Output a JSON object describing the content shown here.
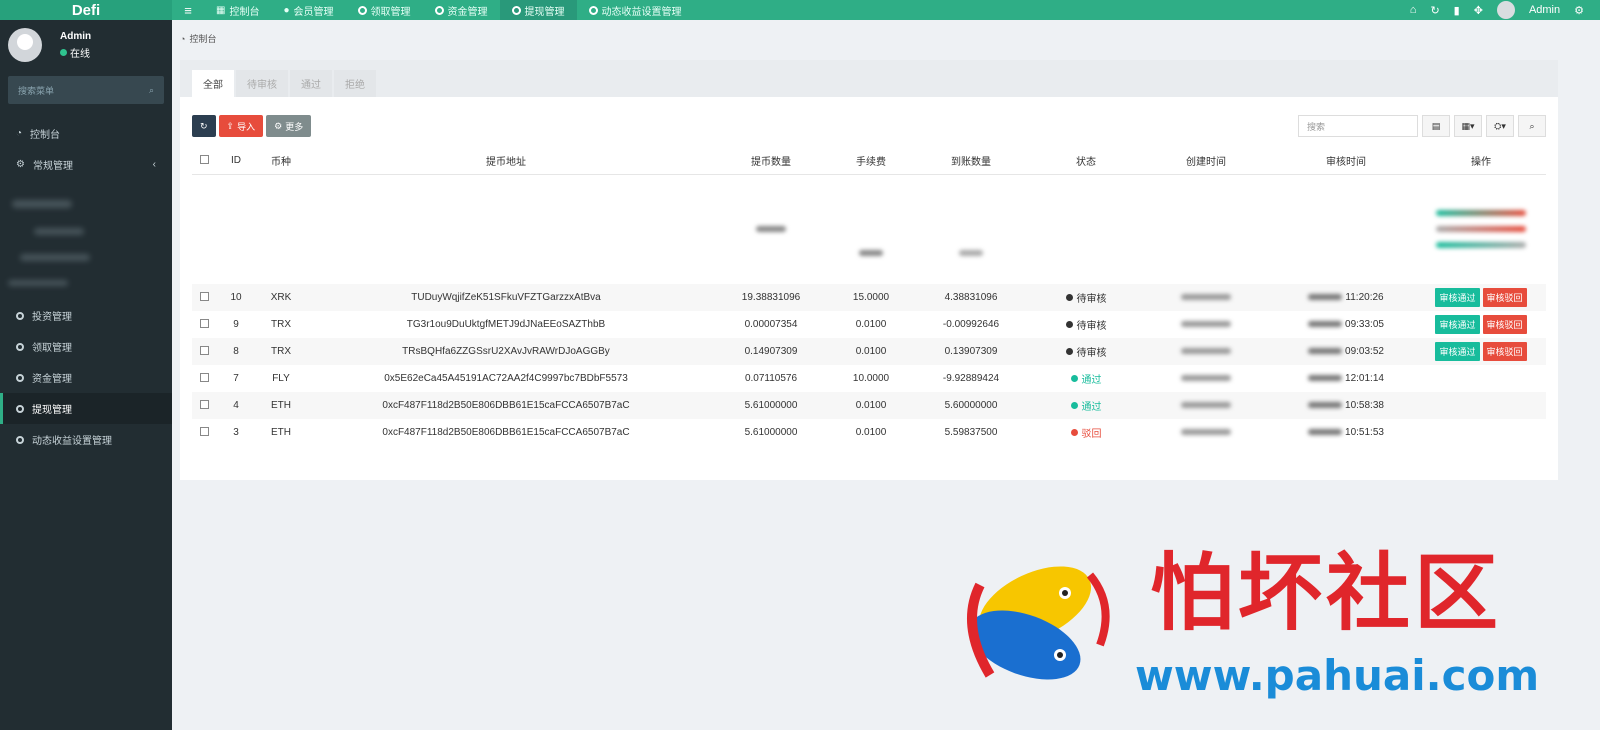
{
  "header": {
    "logo": "Defi",
    "nav": [
      {
        "label": "控制台",
        "icon": "dashboard-icon"
      },
      {
        "label": "会员管理",
        "icon": "user-icon"
      },
      {
        "label": "领取管理",
        "icon": "circle-icon"
      },
      {
        "label": "资金管理",
        "icon": "circle-icon"
      },
      {
        "label": "提现管理",
        "icon": "circle-icon",
        "active": true
      },
      {
        "label": "动态收益设置管理",
        "icon": "circle-icon"
      }
    ],
    "user": "Admin"
  },
  "sidebar": {
    "user": {
      "name": "Admin",
      "status": "在线"
    },
    "search_placeholder": "搜索菜单",
    "items_top": [
      {
        "label": "控制台"
      },
      {
        "label": "常规管理"
      }
    ],
    "items_bottom": [
      {
        "label": "投资管理"
      },
      {
        "label": "领取管理"
      },
      {
        "label": "资金管理"
      },
      {
        "label": "提现管理",
        "active": true
      },
      {
        "label": "动态收益设置管理"
      }
    ]
  },
  "breadcrumb": "控制台",
  "tabs": [
    "全部",
    "待审核",
    "通过",
    "拒绝"
  ],
  "toolbar": {
    "import": "导入",
    "more": "更多",
    "search_placeholder": "搜索"
  },
  "table": {
    "columns": [
      "ID",
      "币种",
      "提币地址",
      "提币数量",
      "手续费",
      "到账数量",
      "状态",
      "创建时间",
      "审核时间",
      "操作"
    ],
    "rows": [
      {
        "id": "10",
        "coin": "XRK",
        "address": "TUDuyWqjifZeK51SFkuVFZTGarzzxAtBva",
        "amount": "19.38831096",
        "fee": "15.0000",
        "received": "4.38831096",
        "status": "待审核",
        "status_color": "#333333",
        "created": "",
        "reviewed": "11:20:26",
        "approve": "审核通过",
        "reject": "审核驳回"
      },
      {
        "id": "9",
        "coin": "TRX",
        "address": "TG3r1ou9DuUktgfMETJ9dJNaEEoSAZThbB",
        "amount": "0.00007354",
        "fee": "0.0100",
        "received": "-0.00992646",
        "status": "待审核",
        "status_color": "#333333",
        "created": "",
        "reviewed": "09:33:05",
        "approve": "审核通过",
        "reject": "审核驳回"
      },
      {
        "id": "8",
        "coin": "TRX",
        "address": "TRsBQHfa6ZZGSsrU2XAvJvRAWrDJoAGGBy",
        "amount": "0.14907309",
        "fee": "0.0100",
        "received": "0.13907309",
        "status": "待审核",
        "status_color": "#333333",
        "created": "",
        "reviewed": "09:03:52",
        "approve": "审核通过",
        "reject": "审核驳回"
      },
      {
        "id": "7",
        "coin": "FLY",
        "address": "0x5E62eCa45A45191AC72AA2f4C9997bc7BDbF5573",
        "amount": "0.07110576",
        "fee": "10.0000",
        "received": "-9.92889424",
        "status": "通过",
        "status_color": "#18bc9c",
        "created": "",
        "reviewed": "12:01:14",
        "approve": "",
        "reject": ""
      },
      {
        "id": "4",
        "coin": "ETH",
        "address": "0xcF487F118d2B50E806DBB61E15caFCCA6507B7aC",
        "amount": "5.61000000",
        "fee": "0.0100",
        "received": "5.60000000",
        "status": "通过",
        "status_color": "#18bc9c",
        "created": "",
        "reviewed": "10:58:38",
        "approve": "",
        "reject": ""
      },
      {
        "id": "3",
        "coin": "ETH",
        "address": "0xcF487F118d2B50E806DBB61E15caFCCA6507B7aC",
        "amount": "5.61000000",
        "fee": "0.0100",
        "received": "5.59837500",
        "status": "驳回",
        "status_color": "#e74c3c",
        "created": "",
        "reviewed": "10:51:53",
        "approve": "",
        "reject": ""
      }
    ]
  },
  "watermark": {
    "title": "怕坏社区",
    "url": "www.pahuai.com"
  },
  "colors": {
    "header": "#2fae86",
    "sidebar": "#222d32",
    "approve": "#18bc9c",
    "reject": "#e74c3c"
  }
}
